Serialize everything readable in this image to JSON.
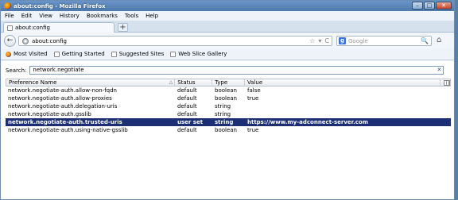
{
  "window": {
    "title": "about:config - Mozilla Firefox",
    "controls": [
      "–",
      "□",
      "✕"
    ]
  },
  "menu": [
    "File",
    "Edit",
    "View",
    "History",
    "Bookmarks",
    "Tools",
    "Help"
  ],
  "tab": {
    "label": "about:config",
    "new_tab": "+"
  },
  "nav": {
    "back": "←",
    "url": "about:config",
    "url_icons": [
      "☆",
      "▾",
      "C"
    ],
    "search_engine": "g",
    "search_placeholder": "Google",
    "search_icon": "🔍",
    "home_icon": "⌂"
  },
  "bookmarks": [
    "Most Visited",
    "Getting Started",
    "Suggested Sites",
    "Web Slice Gallery"
  ],
  "filter": {
    "label": "Search:",
    "value": "network.negotiate",
    "clear": "✕"
  },
  "table": {
    "headers": {
      "name": "Preference Name",
      "status": "Status",
      "type": "Type",
      "value": "Value"
    },
    "sort_indicator": "△",
    "rows": [
      {
        "name": "network.negotiate-auth.allow-non-fqdn",
        "status": "default",
        "type": "boolean",
        "value": "false",
        "selected": false
      },
      {
        "name": "network.negotiate-auth.allow-proxies",
        "status": "default",
        "type": "boolean",
        "value": "true",
        "selected": false
      },
      {
        "name": "network.negotiate-auth.delegation-uris",
        "status": "default",
        "type": "string",
        "value": "",
        "selected": false
      },
      {
        "name": "network.negotiate-auth.gsslib",
        "status": "default",
        "type": "string",
        "value": "",
        "selected": false
      },
      {
        "name": "network.negotiate-auth.trusted-uris",
        "status": "user set",
        "type": "string",
        "value": "https://www.my-adconnect-server.com",
        "selected": true
      },
      {
        "name": "network.negotiate-auth.using-native-gsslib",
        "status": "default",
        "type": "boolean",
        "value": "true",
        "selected": false
      }
    ]
  }
}
